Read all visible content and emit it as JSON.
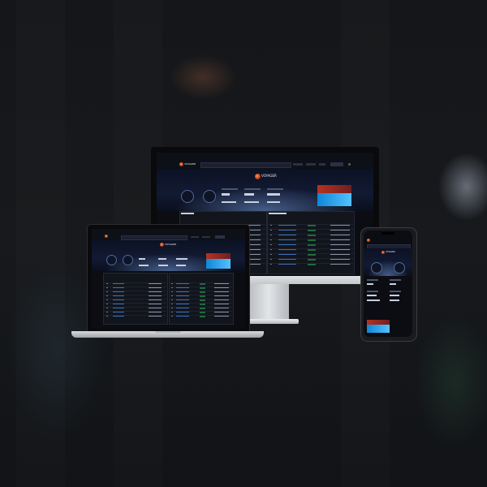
{
  "brand": {
    "name": "VOYAGER"
  },
  "colors": {
    "accent": "#e78c36",
    "success": "#3ecf74",
    "link": "#4aa3ff",
    "panel": "#12151c"
  },
  "icons": [
    "voyager-logo-icon",
    "search-icon",
    "gear-icon",
    "user-icon"
  ]
}
